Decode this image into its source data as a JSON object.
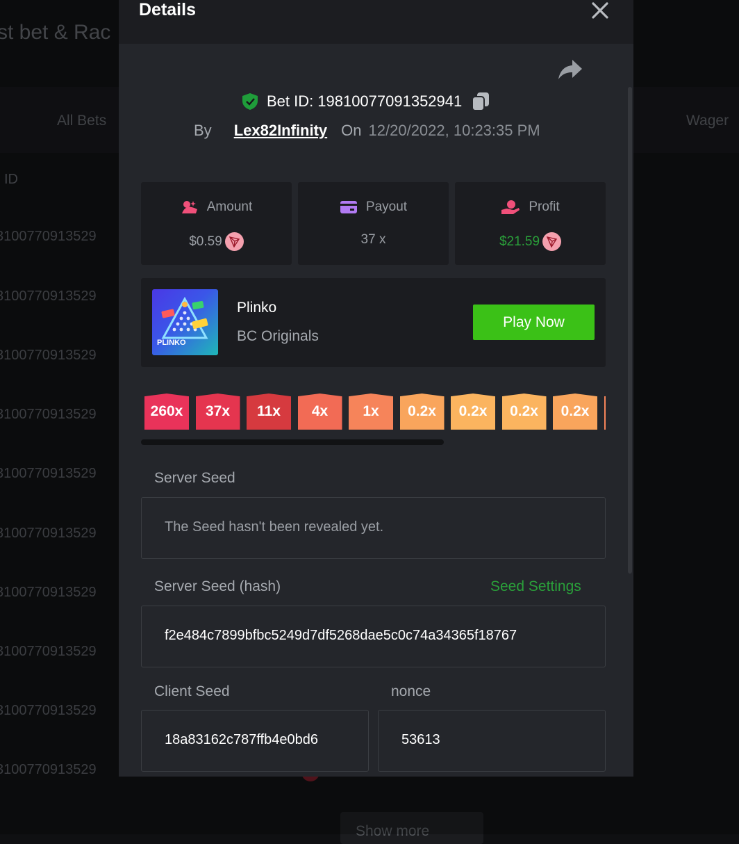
{
  "background": {
    "title": "st bet & Rac",
    "tabs": [
      "All Bets",
      "Wager"
    ],
    "column_header": "ID",
    "row_ids": [
      "3100770913529",
      "3100770913529",
      "3100770913529",
      "3100770913529",
      "3100770913529",
      "3100770913529",
      "3100770913529",
      "3100770913529",
      "3100770913529",
      "3100770913529"
    ],
    "show_more": "Show more"
  },
  "modal": {
    "title": "Details",
    "bet_id_label": "Bet ID:",
    "bet_id": "19810077091352941",
    "by_label": "By",
    "username": "Lex82Infinity",
    "on_label": "On",
    "date": "12/20/2022, 10:23:35 PM",
    "stats": {
      "amount_label": "Amount",
      "amount_value": "$0.59",
      "payout_label": "Payout",
      "payout_value": "37 x",
      "profit_label": "Profit",
      "profit_value": "$21.59"
    },
    "game": {
      "name": "Plinko",
      "provider": "BC Originals",
      "thumb_text": "PLINKO",
      "play_label": "Play Now"
    },
    "multipliers": [
      {
        "label": "260x",
        "color": "#e9335a"
      },
      {
        "label": "37x",
        "color": "#e5354f"
      },
      {
        "label": "11x",
        "color": "#d63a3f"
      },
      {
        "label": "4x",
        "color": "#f26b55"
      },
      {
        "label": "1x",
        "color": "#f6845a"
      },
      {
        "label": "0.2x",
        "color": "#f9a55c"
      },
      {
        "label": "0.2x",
        "color": "#fbb45f"
      },
      {
        "label": "0.2x",
        "color": "#fbb45f"
      },
      {
        "label": "0.2x",
        "color": "#f9a55c"
      },
      {
        "label": "",
        "color": "#f6845a"
      }
    ],
    "server_seed_label": "Server Seed",
    "server_seed_value": "The Seed hasn't been revealed yet.",
    "server_seed_hash_label": "Server Seed (hash)",
    "seed_settings_label": "Seed Settings",
    "server_seed_hash": "f2e484c7899bfbc5249d7df5268dae5c0c74a34365f18767",
    "client_seed_label": "Client Seed",
    "client_seed_value": "18a83162c787ffb4e0bd6",
    "nonce_label": "nonce",
    "nonce_value": "53613"
  },
  "colors": {
    "accent_green": "#3bc117",
    "profit_green": "#2aa03a",
    "modal_bg": "#24262b",
    "panel_bg": "#1b1c20"
  }
}
